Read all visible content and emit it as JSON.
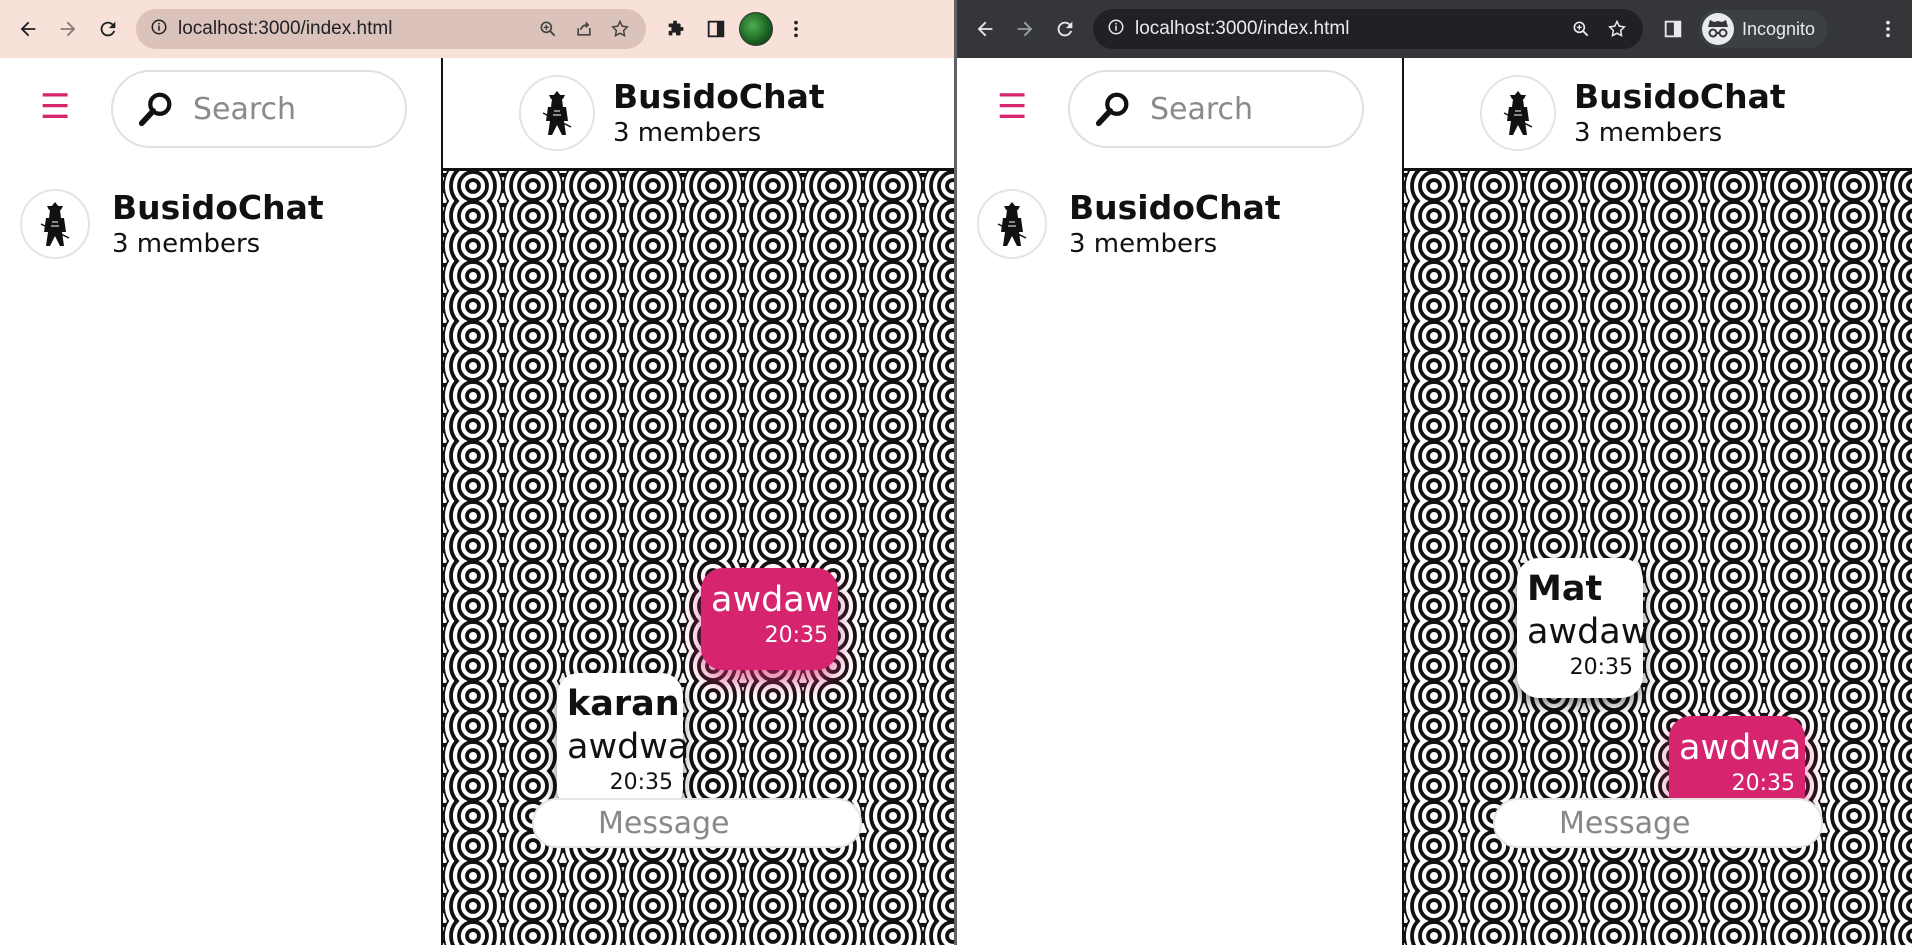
{
  "windows": [
    {
      "browser": {
        "url": "localhost:3000/index.html",
        "incognito_label": ""
      },
      "sidebar": {
        "search_placeholder": "Search",
        "chats": [
          {
            "name": "BusidoChat",
            "members": "3 members"
          }
        ]
      },
      "chat": {
        "title": "BusidoChat",
        "subtitle": "3 members",
        "messages": [
          {
            "direction": "outgoing",
            "sender": "",
            "text": "awdaw",
            "time": "20:35"
          },
          {
            "direction": "incoming",
            "sender": "karan",
            "text": "awdwa",
            "time": "20:35"
          }
        ],
        "input_placeholder": "Message"
      }
    },
    {
      "browser": {
        "url": "localhost:3000/index.html",
        "incognito_label": "Incognito"
      },
      "sidebar": {
        "search_placeholder": "Search",
        "chats": [
          {
            "name": "BusidoChat",
            "members": "3 members"
          }
        ]
      },
      "chat": {
        "title": "BusidoChat",
        "subtitle": "3 members",
        "messages": [
          {
            "direction": "incoming",
            "sender": "Mat",
            "text": "awdaw",
            "time": "20:35"
          },
          {
            "direction": "outgoing",
            "sender": "",
            "text": "awdwa",
            "time": "20:35"
          }
        ],
        "input_placeholder": "Message"
      }
    }
  ],
  "colors": {
    "accent": "#d6246e",
    "left_toolbar": "#f8e1d9",
    "right_toolbar": "#35363a"
  },
  "icons": [
    "back-arrow-icon",
    "forward-arrow-icon",
    "reload-icon",
    "info-icon",
    "zoom-icon",
    "share-icon",
    "star-icon",
    "extensions-icon",
    "side-panel-icon",
    "more-menu-icon",
    "hamburger-menu-icon",
    "search-icon",
    "samurai-avatar-icon",
    "incognito-icon"
  ]
}
